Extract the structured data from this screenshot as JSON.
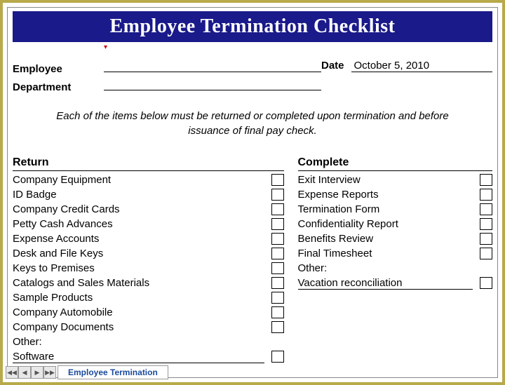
{
  "title": "Employee Termination Checklist",
  "fields": {
    "employee_label": "Employee",
    "employee_value": "",
    "department_label": "Department",
    "department_value": "",
    "date_label": "Date",
    "date_value": "October 5, 2010"
  },
  "instructions": "Each of the items below must be returned or completed upon termination and before issuance of final pay check.",
  "columns": {
    "return": {
      "header": "Return",
      "items": [
        {
          "label": "Company Equipment",
          "checkbox": true
        },
        {
          "label": "ID Badge",
          "checkbox": true
        },
        {
          "label": "Company Credit Cards",
          "checkbox": true
        },
        {
          "label": "Petty Cash Advances",
          "checkbox": true
        },
        {
          "label": "Expense Accounts",
          "checkbox": true
        },
        {
          "label": "Desk and File Keys",
          "checkbox": true
        },
        {
          "label": "Keys to Premises",
          "checkbox": true
        },
        {
          "label": "Catalogs and Sales Materials",
          "checkbox": true
        },
        {
          "label": "Sample Products",
          "checkbox": true
        },
        {
          "label": "Company Automobile",
          "checkbox": true
        },
        {
          "label": "Company Documents",
          "checkbox": true
        },
        {
          "label": "Other:",
          "checkbox": false
        },
        {
          "label": "Software",
          "checkbox": true,
          "underlined": true
        }
      ]
    },
    "complete": {
      "header": "Complete",
      "items": [
        {
          "label": "Exit Interview",
          "checkbox": true
        },
        {
          "label": "Expense Reports",
          "checkbox": true
        },
        {
          "label": "Termination Form",
          "checkbox": true
        },
        {
          "label": "Confidentiality Report",
          "checkbox": true
        },
        {
          "label": "Benefits Review",
          "checkbox": true
        },
        {
          "label": "Final Timesheet",
          "checkbox": true
        },
        {
          "label": "Other:",
          "checkbox": false
        },
        {
          "label": "Vacation reconciliation",
          "checkbox": true,
          "underlined": true
        }
      ]
    }
  },
  "sheet_tab": "Employee Termination"
}
